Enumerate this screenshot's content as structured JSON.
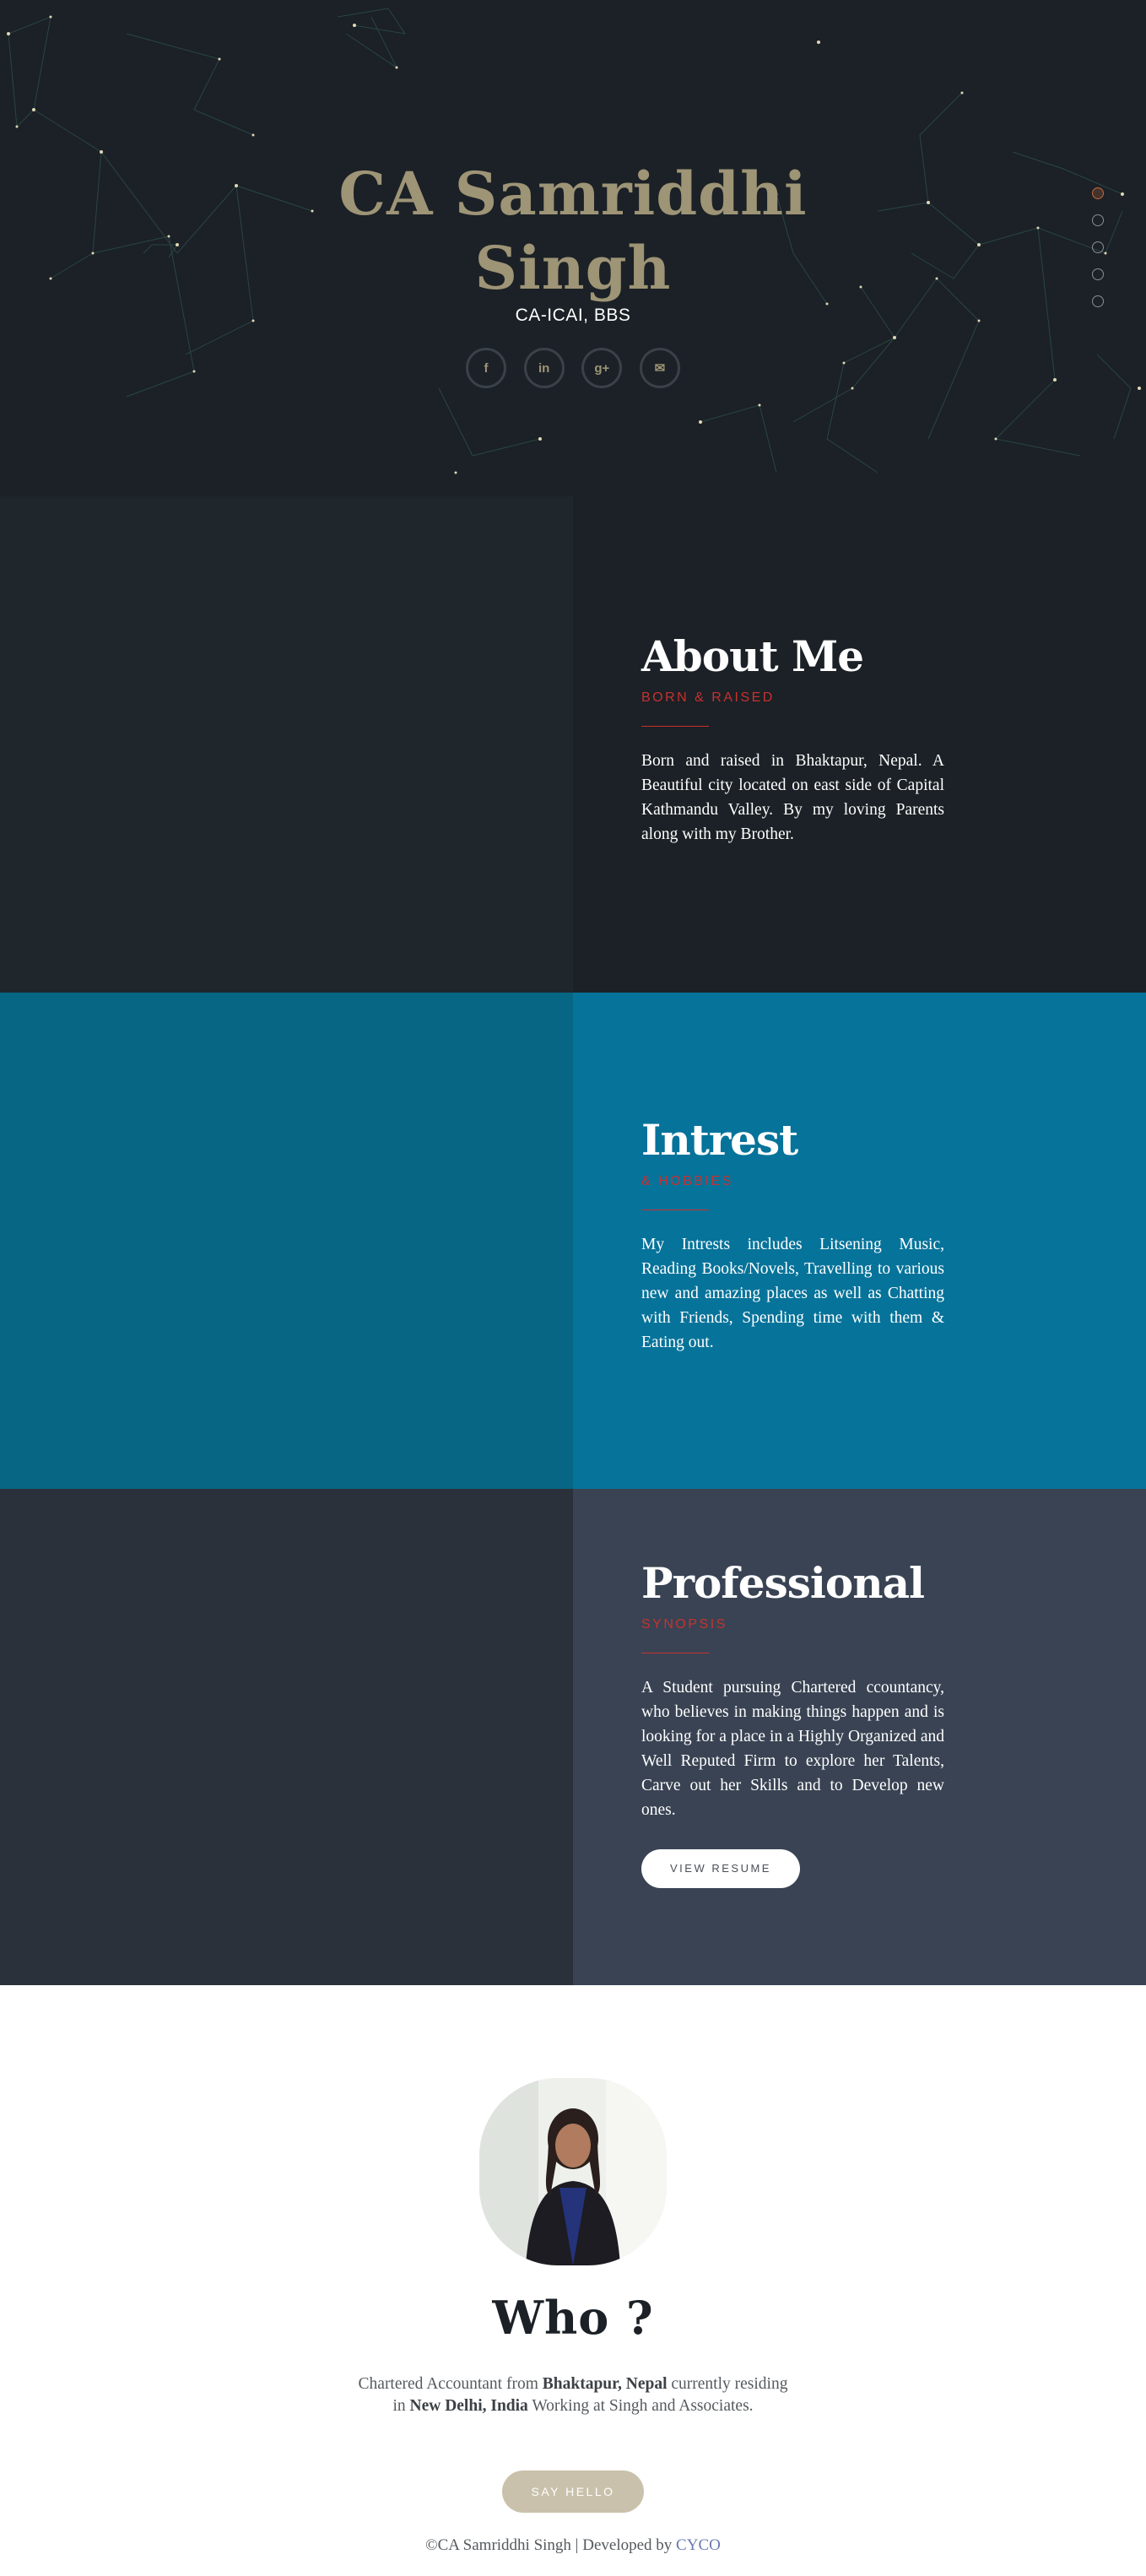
{
  "hero": {
    "name_line1": "CA Samriddhi",
    "name_line2": "Singh",
    "subtitle": "CA-ICAI, BBS",
    "social": [
      {
        "icon": "facebook-icon",
        "glyph": "f"
      },
      {
        "icon": "linkedin-icon",
        "glyph": "in"
      },
      {
        "icon": "google-plus-icon",
        "glyph": "g+"
      },
      {
        "icon": "mail-icon",
        "glyph": "✉"
      }
    ],
    "nav_dots_count": 5,
    "active_dot": 1
  },
  "about": {
    "title": "About Me",
    "tag": "BORN & RAISED",
    "text": "Born and raised in Bhaktapur, Nepal. A Beautiful city located on east side of Capital Kathmandu Valley. By my loving Parents along with my Brother."
  },
  "interest": {
    "title": "Intrest",
    "tag": "& HOBBIES",
    "text": "My Intrests includes Litsening Music, Reading Books/Novels, Travelling to various new and amazing places as well as Chatting with Friends, Spending time with them & Eating out."
  },
  "professional": {
    "title": "Professional",
    "tag": "SYNOPSIS",
    "text": "A Student pursuing Chartered ccountancy, who believes in making things happen and is looking for a place in a Highly Organized and Well Reputed Firm to explore her Talents, Carve out her Skills and to Develop new ones.",
    "button": "VIEW RESUME"
  },
  "who": {
    "title": "Who ?",
    "text_1": "Chartered Accountant from ",
    "text_bold_1": "Bhaktapur, Nepal",
    "text_2": " currently residing in ",
    "text_bold_2": "New Delhi, India",
    "text_3": " Working at Singh and Associates.",
    "button": "SAY HELLO"
  },
  "footer": {
    "text": "©CA Samriddhi Singh | Developed by ",
    "link": "CYCO"
  },
  "colors": {
    "hero_bg": "#1b2126",
    "name_gold": "#9e9476",
    "accent_red": "#c8312f",
    "about_left": "#1f272c",
    "about_right": "#1b2126",
    "interest_left": "#066683",
    "interest_right": "#06739a",
    "professional_left": "#2b313b",
    "professional_right": "#394353",
    "hello_btn": "#c9c1ab"
  }
}
